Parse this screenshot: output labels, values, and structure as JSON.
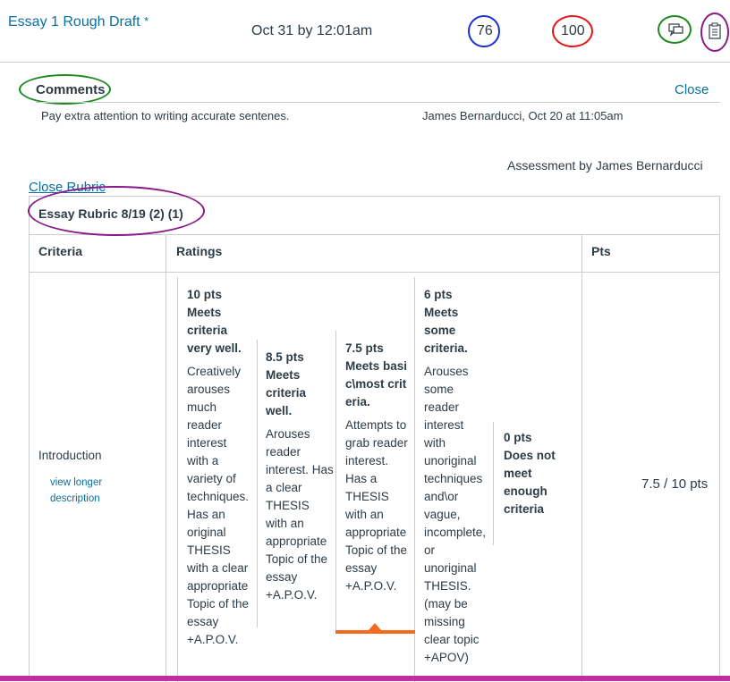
{
  "assignment": {
    "title": "Essay 1 Rough Draft",
    "flag": "*",
    "due": "Oct 31 by 12:01am",
    "score": "76",
    "out_of": "100",
    "annotation_colors": {
      "score": "#1a2fd6",
      "out_of": "#e01a1a",
      "comments_icon": "#1e8a1e",
      "rubric_icon": "#8a1a8a"
    }
  },
  "icons": {
    "comments": "comments-icon",
    "rubric": "rubric-icon"
  },
  "comments": {
    "heading": "Comments",
    "close_label": "Close",
    "items": [
      {
        "text": "Pay extra attention to writing accurate sentenes.",
        "meta": "James Bernarducci, Oct 20 at 11:05am"
      }
    ]
  },
  "assessment_by": "Assessment by James Bernarducci",
  "rubric": {
    "close_label": "Close Rubric",
    "title": "Essay Rubric 8/19 (2) (1)",
    "headers": {
      "criteria": "Criteria",
      "ratings": "Ratings",
      "pts": "Pts"
    },
    "criterion": {
      "name": "Introduction",
      "longer_link": "view longer description",
      "score": "7.5 / 10 pts",
      "ratings": [
        {
          "pts": "10 pts",
          "desc": "Meets criteria very well.",
          "long": "Creatively arouses much reader interest with a variety of techniques. Has an original THESIS with a clear appropriate Topic of the essay +A.P.O.V.",
          "selected": false
        },
        {
          "pts": "8.5 pts",
          "desc": "Meets criteria well.",
          "long": "Arouses reader interest. Has a clear THESIS with an appropriate Topic of the essay +A.P.O.V.",
          "selected": false
        },
        {
          "pts": "7.5 pts",
          "desc": "Meets basic\\most criteria.",
          "long": "Attempts to grab reader interest. Has a THESIS with an appropriate Topic of the essay +A.P.O.V.",
          "selected": true
        },
        {
          "pts": "6 pts",
          "desc": "Meets some criteria.",
          "long": "Arouses some reader interest with unoriginal techniques and\\or vague, incomplete, or unoriginal THESIS. (may be missing clear topic +APOV)",
          "selected": false
        },
        {
          "pts": "0 pts",
          "desc": "Does not meet enough criteria",
          "long": "",
          "selected": false
        }
      ]
    },
    "accent_color": "#f26b1f",
    "bottom_bar_color": "#c02fa0"
  }
}
